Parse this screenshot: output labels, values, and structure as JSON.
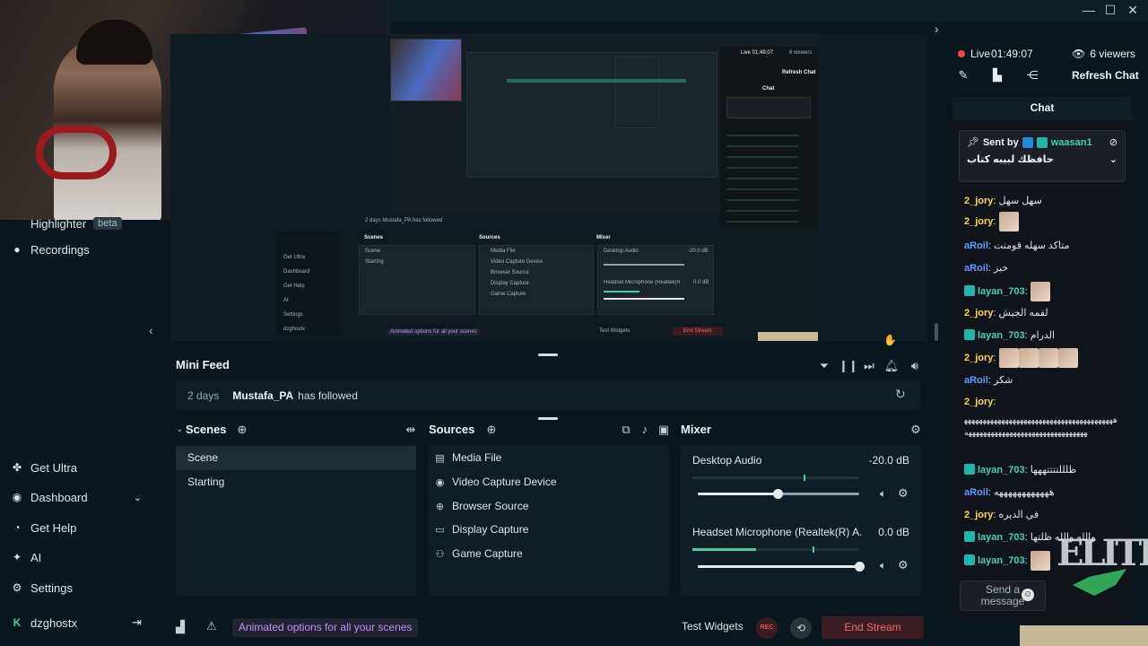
{
  "window": {
    "minimize": "—",
    "maximize": "☐",
    "close": "✕"
  },
  "sidebar": {
    "highlighter_label": "Highlighter",
    "highlighter_badge": "beta",
    "recordings_label": "Recordings",
    "get_ultra_label": "Get Ultra",
    "dashboard_label": "Dashboard",
    "get_help_label": "Get Help",
    "ai_label": "AI",
    "settings_label": "Settings",
    "username": "dzghostx"
  },
  "preview_nested": {
    "chat_title": "Chat",
    "live_time": "Live 01:49:07",
    "viewers": "6 viewers",
    "refresh_chat": "Refresh Chat",
    "feed_text": "2 days  Mustafa_PA  has followed",
    "scenes": "Scenes",
    "sources": "Sources",
    "mixer": "Mixer",
    "scene_items": [
      "Scene",
      "Starting"
    ],
    "source_items": [
      "Media File",
      "Video Capture Device",
      "Browser Source",
      "Display Capture",
      "Game Capture"
    ],
    "mixer_items": [
      "Desktop Audio",
      "Headset Microphone (Realtek(R) A..."
    ],
    "mixer_values": [
      "-20.0 dB",
      "0.0 dB"
    ],
    "side_items": [
      "Get Ultra",
      "Dashboard",
      "Get Help",
      "AI",
      "Settings",
      "dzghostx"
    ],
    "promo": "Animated options for all your scenes",
    "test_widgets": "Test Widgets",
    "end_stream": "End Stream"
  },
  "mini_feed": {
    "title": "Mini Feed",
    "event": {
      "time": "2 days",
      "user": "Mustafa_PA",
      "action": "has followed"
    }
  },
  "scenes": {
    "title": "Scenes",
    "items": [
      "Scene",
      "Starting"
    ],
    "selected": "Scene"
  },
  "sources": {
    "title": "Sources",
    "items": [
      {
        "label": "Media File",
        "icon": "file-icon"
      },
      {
        "label": "Video Capture Device",
        "icon": "camera-icon"
      },
      {
        "label": "Browser Source",
        "icon": "globe-icon"
      },
      {
        "label": "Display Capture",
        "icon": "monitor-icon"
      },
      {
        "label": "Game Capture",
        "icon": "gamepad-icon"
      }
    ]
  },
  "mixer": {
    "title": "Mixer",
    "channels": [
      {
        "label": "Desktop Audio",
        "db": "-20.0 dB",
        "meter_level": 0.0,
        "slider_level": 0.5
      },
      {
        "label": "Headset Microphone (Realtek(R) A...",
        "db": "0.0 dB",
        "meter_level": 0.38,
        "slider_level": 1.0
      }
    ]
  },
  "bottom_bar": {
    "promo": "Animated options for all your scenes",
    "test_widgets": "Test Widgets",
    "rec": "REC",
    "end_stream": "End Stream"
  },
  "chat_panel": {
    "live_label": "Live",
    "live_time": "01:49:07",
    "viewers": "6 viewers",
    "refresh_chat": "Refresh Chat",
    "chat_title": "Chat",
    "pinned": {
      "sent_by": "Sent by",
      "user": "waasan1",
      "message": "حافظك لبيبه كتاب"
    },
    "messages": [
      {
        "user": "2_jory",
        "color": "jory",
        "text": "سهل سهل"
      },
      {
        "user": "2_jory",
        "color": "jory",
        "text": ""
      },
      {
        "user": "aRoil",
        "color": "aroil",
        "text": "متاكد سهله قومنت"
      },
      {
        "user": "aRoil",
        "color": "aroil",
        "text": "خبز"
      },
      {
        "user": "layan_703",
        "color": "layan",
        "text": ""
      },
      {
        "user": "2_jory",
        "color": "jory",
        "text": "لقمه الجيش"
      },
      {
        "user": "layan_703",
        "color": "layan",
        "text": "الدرام"
      },
      {
        "user": "2_jory",
        "color": "jory",
        "text": ""
      },
      {
        "user": "aRoil",
        "color": "aroil",
        "text": "شكر"
      },
      {
        "user": "2_jory",
        "color": "jory",
        "text": ""
      },
      {
        "user": "layan_703",
        "color": "layan",
        "text": "ظلللتتتتههها"
      },
      {
        "user": "aRoil",
        "color": "aroil",
        "text": "ههههههههههههه"
      },
      {
        "user": "2_jory",
        "color": "jory",
        "text": "في الديره"
      },
      {
        "user": "layan_703",
        "color": "layan",
        "text": "والله والله ظلتها"
      },
      {
        "user": "layan_703",
        "color": "layan",
        "text": ""
      }
    ],
    "long_message": "هههههههههههههههههههههههههههههههههههههههههههههههههههههههههههههههههههههههههه",
    "send_placeholder": "Send a message",
    "logo_text": "ELITE"
  },
  "colors": {
    "accent_teal": "#3fd39a",
    "live_red": "#f04848",
    "promo_purple": "#c78cf5",
    "end_stream_red": "#f26a6a",
    "user_jory": "#ffd84a",
    "user_aroil": "#5aa0ff",
    "user_layan": "#3fd3b5"
  }
}
